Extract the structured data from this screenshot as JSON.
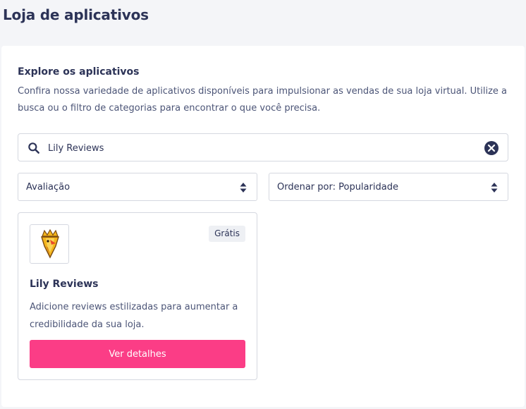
{
  "header": {
    "title": "Loja de aplicativos"
  },
  "explore": {
    "title": "Explore os aplicativos",
    "description": "Confira nossa variedade de aplicativos disponíveis para impulsionar as vendas de sua loja virtual. Utilize a busca ou o filtro de categorias para encontrar o que você precisa."
  },
  "search": {
    "value": "Lily Reviews"
  },
  "filters": {
    "category": {
      "selected": "Avaliação"
    },
    "sort": {
      "selected": "Ordenar por: Popularidade"
    }
  },
  "apps": [
    {
      "name": "Lily Reviews",
      "price_badge": "Grátis",
      "description": "Adicione reviews estilizadas para aumentar a credibilidade da sua loja.",
      "button_label": "Ver detalhes"
    }
  ],
  "colors": {
    "primary_button": "#fb3d86",
    "text_primary": "#2c3357",
    "background": "#f4f5f8"
  },
  "icons": {
    "search": "search-icon",
    "clear": "close-circle-icon",
    "select_arrows": "sort-arrows-icon",
    "app_logo": "lily-reviews-logo"
  }
}
